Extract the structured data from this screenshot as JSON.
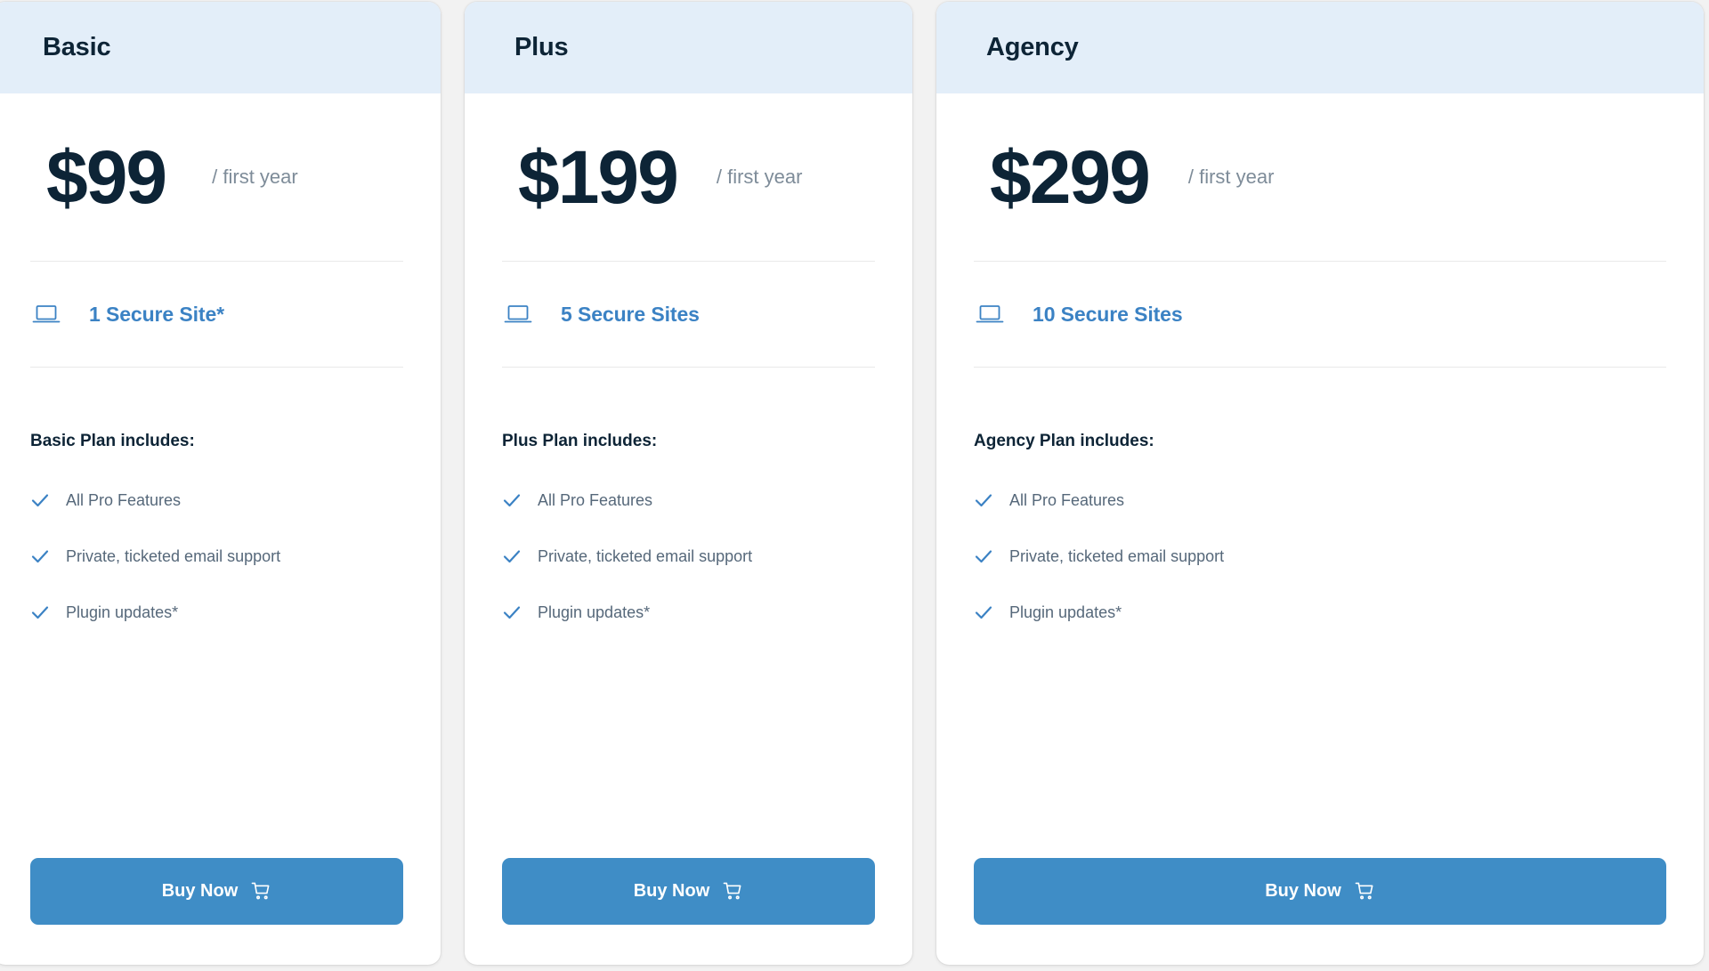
{
  "colors": {
    "page_background": "#f2f2f2",
    "card_background": "#ffffff",
    "header_background": "#e3eef9",
    "title_text": "#0d2436",
    "price_text": "#0d2436",
    "period_text": "#7e8c99",
    "accent_blue": "#3b82c4",
    "feature_text": "#56687a",
    "button_background": "#3f8dc6",
    "button_text": "#ffffff",
    "divider": "#e9e9e9"
  },
  "plans": [
    {
      "name": "Basic",
      "price": "$99",
      "period": "/ first year",
      "sites": "1 Secure Site*",
      "sites_icon": "laptop-icon",
      "includes_title": "Basic Plan includes:",
      "features": [
        "All Pro Features",
        "Private, ticketed email support",
        "Plugin updates*"
      ],
      "feature_icon": "check-icon",
      "buy_label": "Buy Now",
      "buy_icon": "shopping-cart-icon"
    },
    {
      "name": "Plus",
      "price": "$199",
      "period": "/ first year",
      "sites": "5 Secure Sites",
      "sites_icon": "laptop-icon",
      "includes_title": "Plus Plan includes:",
      "features": [
        "All Pro Features",
        "Private, ticketed email support",
        "Plugin updates*"
      ],
      "feature_icon": "check-icon",
      "buy_label": "Buy Now",
      "buy_icon": "shopping-cart-icon"
    },
    {
      "name": "Agency",
      "price": "$299",
      "period": "/ first year",
      "sites": "10 Secure Sites",
      "sites_icon": "laptop-icon",
      "includes_title": "Agency Plan includes:",
      "features": [
        "All Pro Features",
        "Private, ticketed email support",
        "Plugin updates*"
      ],
      "feature_icon": "check-icon",
      "buy_label": "Buy Now",
      "buy_icon": "shopping-cart-icon"
    }
  ]
}
